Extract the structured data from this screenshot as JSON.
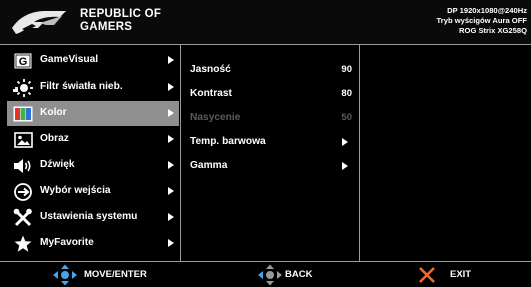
{
  "header": {
    "brand_line1": "REPUBLIC OF",
    "brand_line2": "GAMERS",
    "status_line1": "DP  1920x1080@240Hz",
    "status_line2": "Tryb wyścigów   Aura OFF",
    "status_line3": "ROG Strix XG258Q"
  },
  "menu": {
    "items": [
      {
        "label": "GameVisual",
        "icon": "gamevisual-icon"
      },
      {
        "label": "Filtr światła nieb.",
        "icon": "blue-light-icon"
      },
      {
        "label": "Kolor",
        "icon": "color-icon",
        "selected": true
      },
      {
        "label": "Obraz",
        "icon": "image-icon"
      },
      {
        "label": "Dźwięk",
        "icon": "speaker-icon"
      },
      {
        "label": "Wybór wejścia",
        "icon": "input-icon"
      },
      {
        "label": "Ustawienia systemu",
        "icon": "tools-icon"
      },
      {
        "label": "MyFavorite",
        "icon": "star-icon"
      }
    ]
  },
  "submenu": {
    "items": [
      {
        "label": "Jasność",
        "value": "90"
      },
      {
        "label": "Kontrast",
        "value": "80"
      },
      {
        "label": "Nasycenie",
        "value": "50",
        "disabled": true
      },
      {
        "label": "Temp. barwowa",
        "value": ""
      },
      {
        "label": "Gamma",
        "value": ""
      }
    ]
  },
  "footer": {
    "move_label": "MOVE/ENTER",
    "back_label": "BACK",
    "exit_label": "EXIT"
  },
  "colors": {
    "background": "#000000",
    "selected_row": "#8f8f8f",
    "divider": "#9a9a9a",
    "joystick_blue": "#4aa3e8",
    "exit_orange": "#f26b2e",
    "disabled_text": "#5b5b5b"
  }
}
